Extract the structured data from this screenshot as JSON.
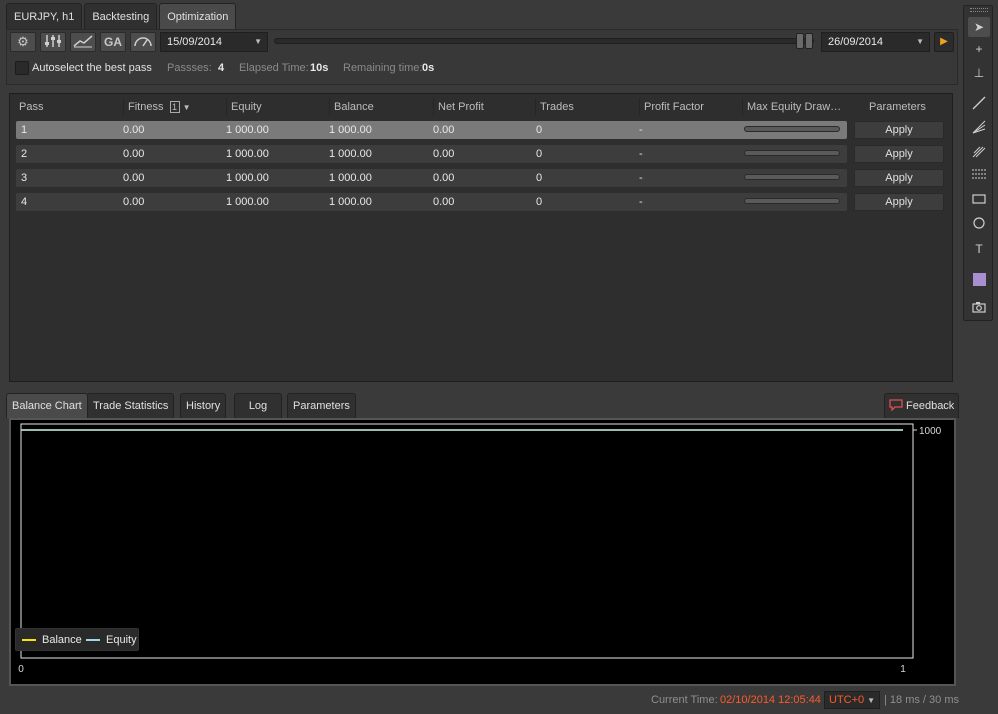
{
  "top_tabs": [
    {
      "label": "EURJPY, h1"
    },
    {
      "label": "Backtesting"
    },
    {
      "label": "Optimization"
    }
  ],
  "toolbar": {
    "icons": [
      "settings-gear-icon",
      "sliders-icon",
      "chart-line-icon",
      "ga-icon",
      "speedometer-icon"
    ],
    "ga_label": "GA",
    "start_date": "15/09/2014",
    "end_date": "26/09/2014",
    "autoselect_label": "Autoselect the best pass",
    "passes_label": "Passses:",
    "passes_value": "4",
    "elapsed_label": "Elapsed Time:",
    "elapsed_value": "10s",
    "remaining_label": "Remaining time:",
    "remaining_value": "0s"
  },
  "table": {
    "columns": [
      "Pass",
      "Fitness",
      "Equity",
      "Balance",
      "Net Profit",
      "Trades",
      "Profit Factor",
      "Max Equity Draw…",
      "Parameters"
    ],
    "sort_badge": "1",
    "apply_label": "Apply",
    "rows": [
      {
        "pass": "1",
        "fitness": "0.00",
        "equity": "1 000.00",
        "balance": "1 000.00",
        "net_profit": "0.00",
        "trades": "0",
        "profit_factor": "-"
      },
      {
        "pass": "2",
        "fitness": "0.00",
        "equity": "1 000.00",
        "balance": "1 000.00",
        "net_profit": "0.00",
        "trades": "0",
        "profit_factor": "-"
      },
      {
        "pass": "3",
        "fitness": "0.00",
        "equity": "1 000.00",
        "balance": "1 000.00",
        "net_profit": "0.00",
        "trades": "0",
        "profit_factor": "-"
      },
      {
        "pass": "4",
        "fitness": "0.00",
        "equity": "1 000.00",
        "balance": "1 000.00",
        "net_profit": "0.00",
        "trades": "0",
        "profit_factor": "-"
      }
    ]
  },
  "bottom_tabs": [
    {
      "label": "Balance Chart"
    },
    {
      "label": "Trade Statistics"
    },
    {
      "label": "History"
    },
    {
      "label": "Log"
    },
    {
      "label": "Parameters"
    }
  ],
  "feedback_label": "Feedback",
  "chart_data": {
    "type": "line",
    "x": [
      0,
      1
    ],
    "series": [
      {
        "name": "Balance",
        "values": [
          1000,
          1000
        ],
        "color": "#f2e600"
      },
      {
        "name": "Equity",
        "values": [
          1000,
          1000
        ],
        "color": "#9fd6ea"
      }
    ],
    "x_ticks": [
      "0",
      "1"
    ],
    "y_ticks": [
      "1000"
    ],
    "legend_position": "bottom-left"
  },
  "status_bar": {
    "current_time_label": "Current Time:",
    "current_time_value": "02/10/2014 12:05:44",
    "timezone": "UTC+0",
    "latency": "| 18 ms / 30 ms"
  },
  "colors": {
    "accent_orange": "#f2a11f",
    "time_red": "#ff5a2a"
  }
}
